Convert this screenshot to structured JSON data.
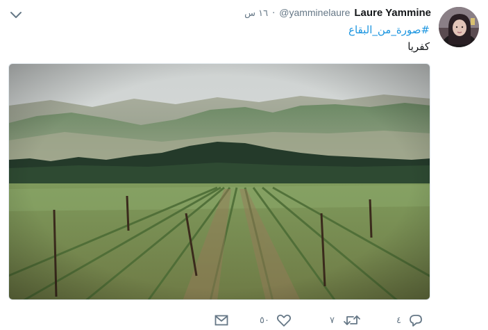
{
  "tweet": {
    "author_name": "Laure Yammine",
    "author_handle": "@yamminelaure",
    "separator": "·",
    "time": "١٦ س",
    "hashtag": "#صورة_من_البقاع",
    "text": "كفريا"
  },
  "actions": {
    "reply_count": "٤",
    "retweet_count": "٧",
    "like_count": "٥٠"
  },
  "icons": {
    "menu": "chevron-down-icon",
    "reply": "reply-icon",
    "retweet": "retweet-icon",
    "like": "heart-icon",
    "message": "envelope-icon"
  },
  "colors": {
    "link": "#1b95e0",
    "muted": "#657786",
    "text": "#14171a"
  }
}
